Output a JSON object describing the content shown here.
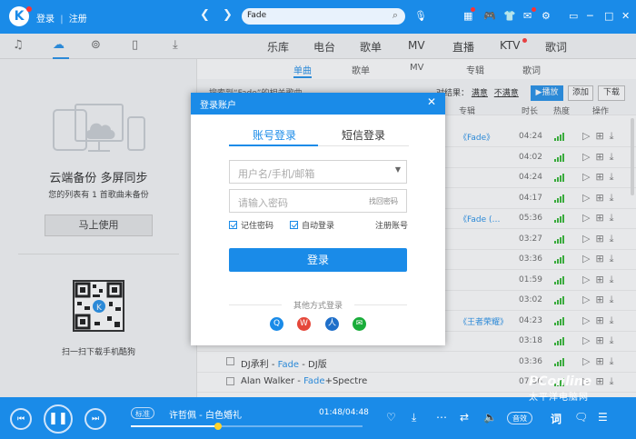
{
  "app": {
    "logo_letter": "K",
    "login": "登录",
    "divider": "|",
    "register": "注册"
  },
  "search": {
    "value": "Fade"
  },
  "top_right_icons": [
    "skin-icon",
    "game-icon",
    "shirt-icon",
    "message-icon",
    "settings-icon",
    "mini-mode-icon",
    "minimize-icon",
    "maximize-icon",
    "close-icon"
  ],
  "left_tabs": [
    "music-icon",
    "cloud-icon",
    "radio-icon",
    "phone-icon",
    "download-icon"
  ],
  "main_tabs": [
    "乐库",
    "电台",
    "歌单",
    "MV",
    "直播",
    "KTV",
    "歌词"
  ],
  "sub_tabs": [
    "单曲",
    "歌单",
    "MV",
    "专辑",
    "歌词"
  ],
  "left_panel": {
    "title": "云端备份 多屏同步",
    "subtitle": "您的列表有 1 首歌曲未备份",
    "button": "马上使用",
    "qr_caption": "扫一扫下载手机酷狗"
  },
  "results": {
    "label": "搜索到“Fade”的相关歌曲",
    "filter_label": "对结果：",
    "filter_a": "满意",
    "filter_b": "不满意",
    "play_all": "播放",
    "add": "添加",
    "download": "下载"
  },
  "columns": {
    "album": "专辑",
    "duration": "时长",
    "hot": "热度",
    "actions": "操作"
  },
  "rows": [
    {
      "song": "",
      "artist_hl": "",
      "suffix": "",
      "album": "《Fade》",
      "dur": "04:24"
    },
    {
      "song": "",
      "artist_hl": "",
      "suffix": "",
      "album": "",
      "dur": "04:02"
    },
    {
      "song": "",
      "artist_hl": "",
      "suffix": "",
      "album": "",
      "dur": "04:24"
    },
    {
      "song": "",
      "artist_hl": "",
      "suffix": "",
      "album": "",
      "dur": "04:17"
    },
    {
      "song": "",
      "artist_hl": "",
      "suffix": "",
      "album": "《Fade (…",
      "dur": "05:36"
    },
    {
      "song": "",
      "artist_hl": "",
      "suffix": "",
      "album": "",
      "dur": "03:27"
    },
    {
      "song": "",
      "artist_hl": "",
      "suffix": "",
      "album": "",
      "dur": "03:36"
    },
    {
      "song": "",
      "artist_hl": "",
      "suffix": "",
      "album": "",
      "dur": "01:59"
    },
    {
      "song": "",
      "artist_hl": "",
      "suffix": "",
      "album": "",
      "dur": "03:02"
    },
    {
      "song": "",
      "artist_hl": "",
      "suffix": "",
      "album": "《王者荣耀》",
      "dur": "04:23"
    },
    {
      "song": "",
      "artist_hl": "",
      "suffix": "",
      "album": "",
      "dur": "03:18"
    },
    {
      "song": "DJ承利 - ",
      "artist_hl": "Fade",
      "suffix": " - DJ版",
      "album": "",
      "dur": "03:36"
    },
    {
      "song": "Alan Walker - ",
      "artist_hl": "Fade",
      "suffix": "+Spectre",
      "album": "",
      "dur": "07:36"
    }
  ],
  "dialog": {
    "title": "登录账户",
    "tab_account": "账号登录",
    "tab_sms": "短信登录",
    "user_placeholder": "用户名/手机/邮箱",
    "pwd_placeholder": "请输入密码",
    "forgot": "找回密码",
    "remember": "记住密码",
    "auto_login": "自动登录",
    "register": "注册账号",
    "login_button": "登录",
    "other": "其他方式登录",
    "socials": [
      "qq-icon",
      "weibo-icon",
      "renren-icon",
      "wechat-icon"
    ]
  },
  "player": {
    "quality": "标准",
    "song": "许哲佩 - 白色婚礼",
    "time": "01:48/04:48",
    "progress": 0.375,
    "quality2": "音效",
    "lyric_btn": "词",
    "colors": {
      "accent": "#1a8be8"
    }
  },
  "watermark": {
    "line1": "PConline",
    "line2": "太平洋电脑网"
  }
}
